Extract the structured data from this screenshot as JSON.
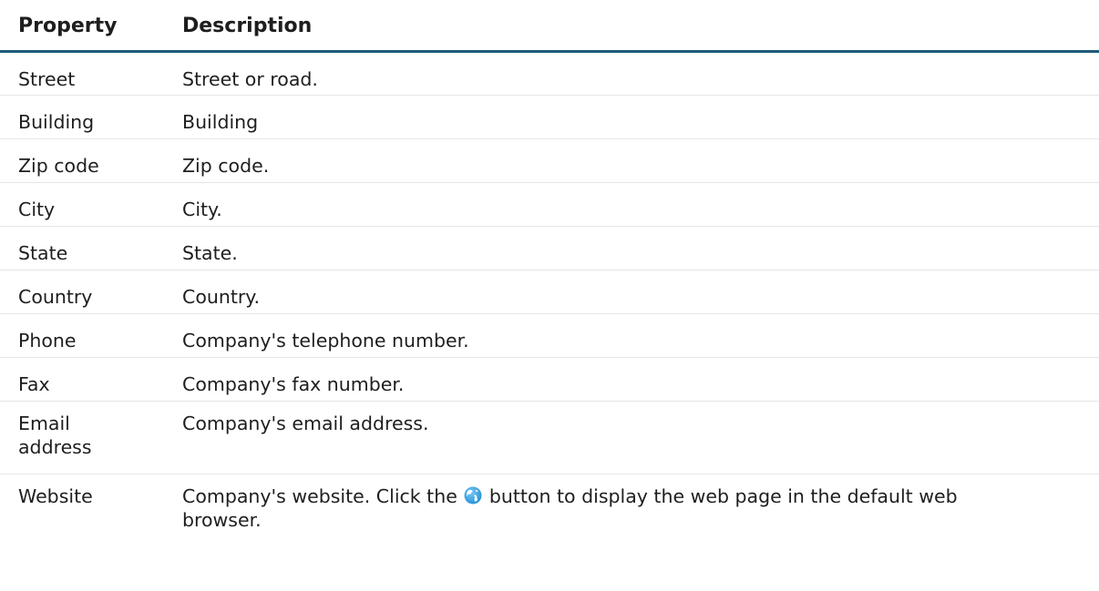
{
  "table": {
    "headers": [
      "Property",
      "Description"
    ],
    "rows": [
      {
        "property": "Street",
        "description": "Street or road."
      },
      {
        "property": "Building",
        "description": "Building"
      },
      {
        "property": "Zip code",
        "description": "Zip code."
      },
      {
        "property": "City",
        "description": "City."
      },
      {
        "property": "State",
        "description": "State."
      },
      {
        "property": "Country",
        "description": "Country."
      },
      {
        "property": "Phone",
        "description": "Company's telephone number."
      },
      {
        "property": "Fax",
        "description": "Company's fax number."
      },
      {
        "property": "Email address",
        "description": "Company's email address."
      },
      {
        "property": "Website",
        "description_before_icon": "Company's website. Click the",
        "description_after_icon": "button to display the web page in the default web browser."
      }
    ]
  },
  "icons": {
    "website_button": "globe-icon"
  },
  "colors": {
    "header_rule": "#1d5b79",
    "row_divider": "#e6e6e6",
    "globe": "#1f8fd6"
  }
}
